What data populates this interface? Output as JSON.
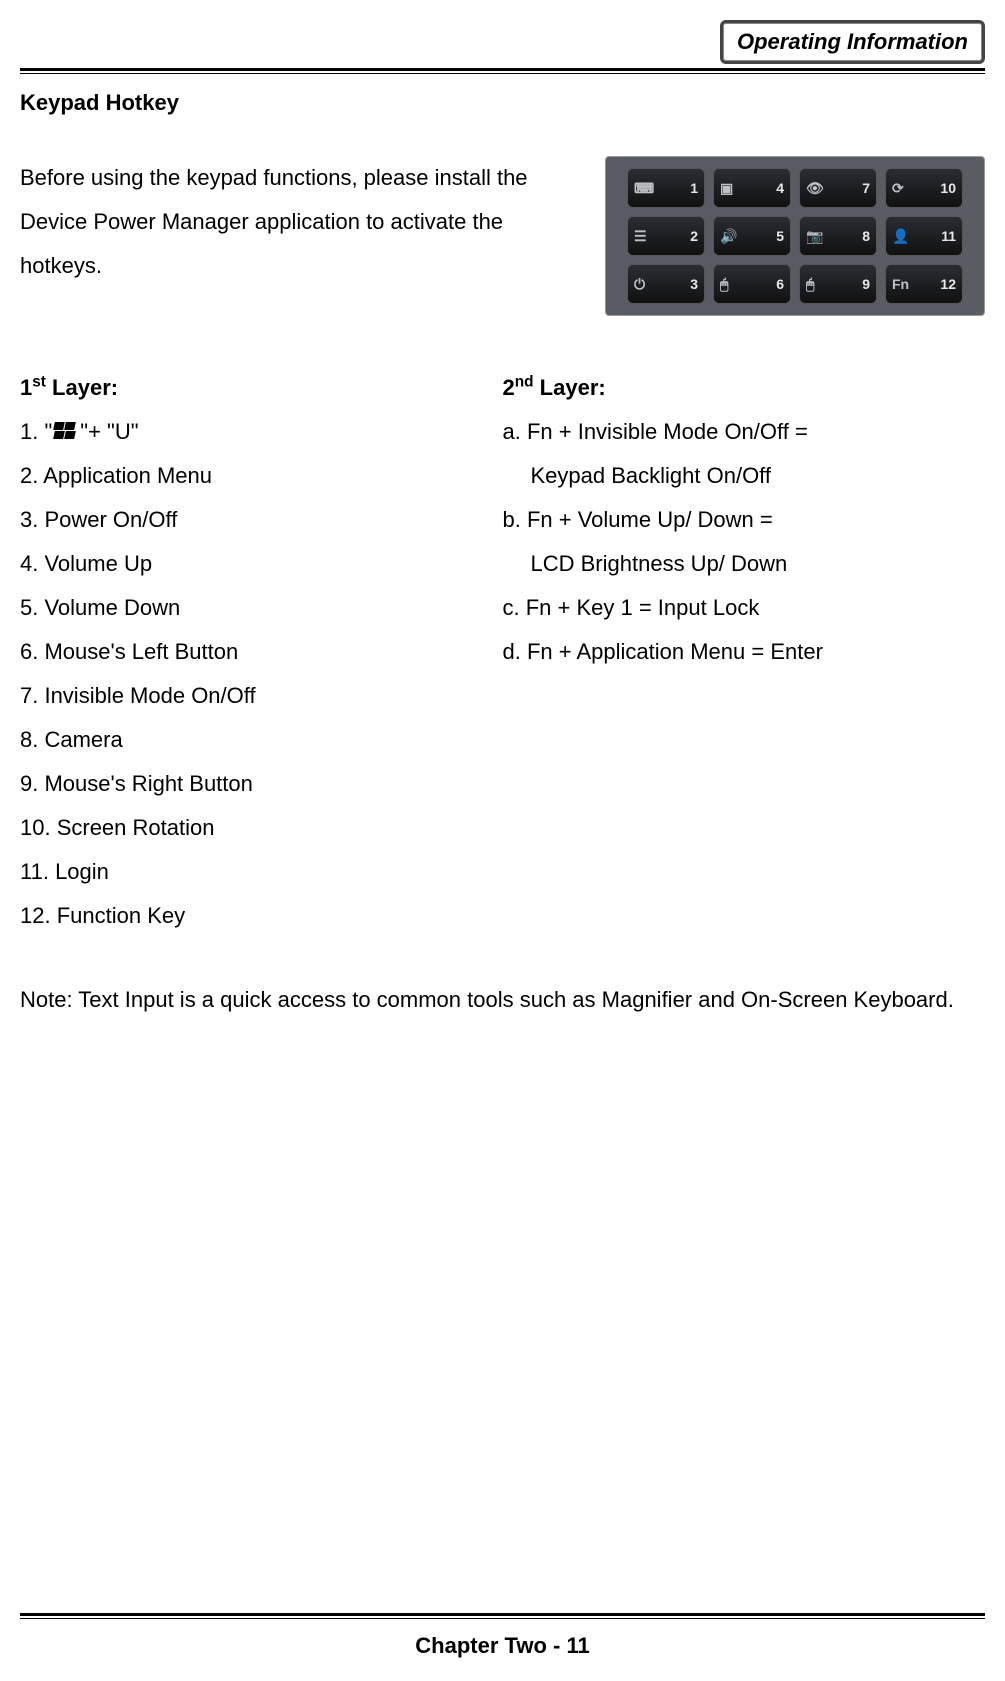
{
  "header": {
    "badge": "Operating Information"
  },
  "title": "Keypad Hotkey",
  "intro": "Before using the keypad functions, please install the Device Power Manager application to activate the hotkeys.",
  "keypad": {
    "keys": [
      {
        "glyph": "⌨",
        "num": "1"
      },
      {
        "glyph": "▣",
        "num": "4"
      },
      {
        "glyph": "👁",
        "num": "7"
      },
      {
        "glyph": "⟳",
        "num": "10"
      },
      {
        "glyph": "☰",
        "num": "2"
      },
      {
        "glyph": "🔊",
        "num": "5"
      },
      {
        "glyph": "📷",
        "num": "8"
      },
      {
        "glyph": "👤",
        "num": "11"
      },
      {
        "glyph": "⏻",
        "num": "3"
      },
      {
        "glyph": "🖱",
        "num": "6"
      },
      {
        "glyph": "🖱",
        "num": "9"
      },
      {
        "glyph": "Fn",
        "num": "12"
      }
    ]
  },
  "layers": {
    "first": {
      "heading_pre": "1",
      "heading_sup": "st",
      "heading_post": " Layer:",
      "item1_pre": "1. \"",
      "item1_post": "\"+ \"U\"",
      "items": [
        "2. Application Menu",
        "3. Power On/Off",
        "4. Volume Up",
        "5. Volume Down",
        "6. Mouse's Left Button",
        "7. Invisible Mode On/Off",
        "8. Camera",
        "9. Mouse's Right Button",
        "10. Screen Rotation",
        "11. Login",
        "12. Function Key"
      ]
    },
    "second": {
      "heading_pre": "2",
      "heading_sup": "nd",
      "heading_post": " Layer:",
      "a1": "a. Fn + Invisible Mode On/Off =",
      "a2": "Keypad Backlight On/Off",
      "b1": "b. Fn + Volume Up/ Down =",
      "b2": "LCD Brightness Up/ Down",
      "c": "c. Fn + Key 1 = Input Lock",
      "d": "d. Fn + Application Menu = Enter"
    }
  },
  "note": "Note: Text Input is a quick access to common tools such as Magnifier and On-Screen Keyboard.",
  "footer": "Chapter Two - 11"
}
